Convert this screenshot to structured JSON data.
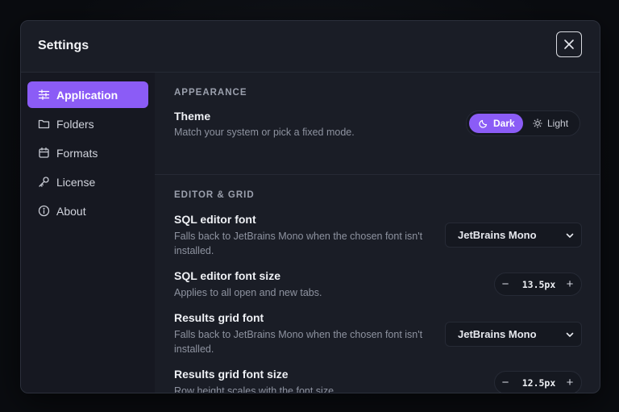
{
  "dialog": {
    "title": "Settings"
  },
  "sidebar": {
    "items": [
      {
        "label": "Application",
        "icon": "sliders-icon",
        "active": true
      },
      {
        "label": "Folders",
        "icon": "folder-icon"
      },
      {
        "label": "Formats",
        "icon": "calendar-icon"
      },
      {
        "label": "License",
        "icon": "key-icon"
      },
      {
        "label": "About",
        "icon": "info-icon"
      }
    ]
  },
  "appearance": {
    "section_title": "APPEARANCE",
    "theme": {
      "label": "Theme",
      "desc": "Match your system or pick a fixed mode.",
      "options": {
        "dark": "Dark",
        "light": "Light"
      },
      "selected": "Dark"
    }
  },
  "editor": {
    "section_title": "EDITOR & GRID",
    "sql_font": {
      "label": "SQL editor font",
      "desc": "Falls back to JetBrains Mono when the chosen font isn't installed.",
      "value": "JetBrains Mono"
    },
    "sql_font_size": {
      "label": "SQL editor font size",
      "desc": "Applies to all open and new tabs.",
      "value": "13.5px"
    },
    "grid_font": {
      "label": "Results grid font",
      "desc": "Falls back to JetBrains Mono when the chosen font isn't installed.",
      "value": "JetBrains Mono"
    },
    "grid_font_size": {
      "label": "Results grid font size",
      "desc": "Row height scales with the font size.",
      "value": "12.5px"
    }
  },
  "colors": {
    "accent": "#8b5cf6",
    "panel": "#1a1d26",
    "sidebar": "#161821"
  }
}
